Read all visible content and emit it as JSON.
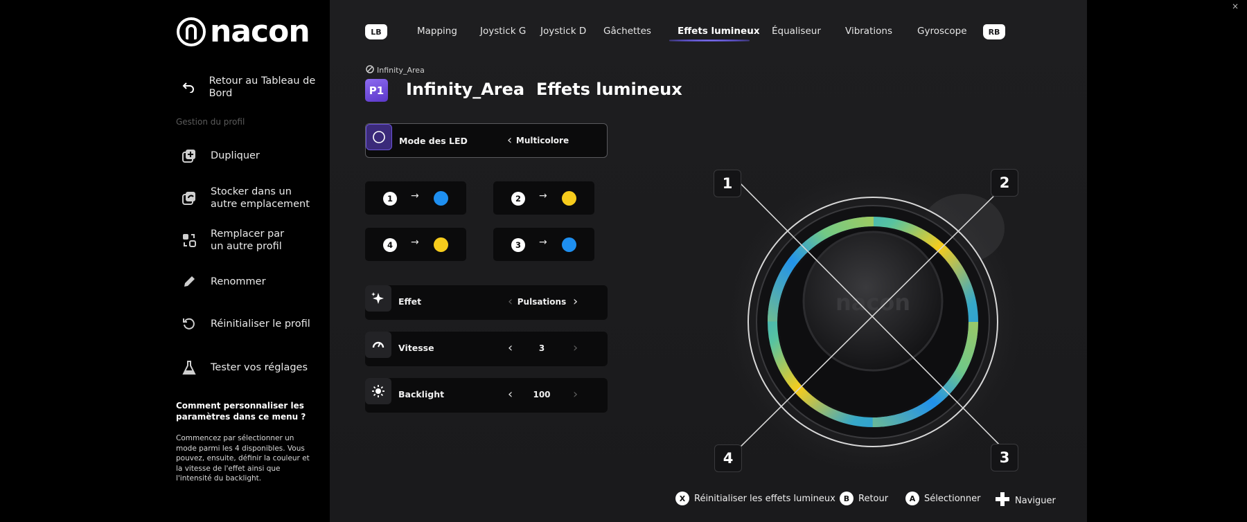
{
  "brand": {
    "logo_text": "nacon"
  },
  "sidebar": {
    "back_label": "Retour au Tableau de Bord",
    "section_label": "Gestion du profil",
    "items": [
      {
        "label": "Dupliquer",
        "icon": "duplicate-icon"
      },
      {
        "label": "Stocker dans un\nautre emplacement",
        "icon": "store-icon"
      },
      {
        "label": "Remplacer par\nun autre profil",
        "icon": "replace-icon"
      },
      {
        "label": "Renommer",
        "icon": "pencil-icon"
      },
      {
        "label": "Réinitialiser le profil",
        "icon": "reset-icon"
      },
      {
        "label": "Tester vos réglages",
        "icon": "flask-icon"
      }
    ],
    "help_title": "Comment personnaliser les paramètres dans ce menu ?",
    "help_text": "Commencez par sélectionner un mode parmi les 4 disponibles. Vous pouvez, ensuite, définir la couleur et la vitesse de l'effet ainsi que l'intensité du backlight."
  },
  "tabs": {
    "left_bumper": "LB",
    "right_bumper": "RB",
    "items": [
      "Mapping",
      "Joystick G",
      "Joystick D",
      "Gâchettes",
      "Effets lumineux",
      "Équaliseur",
      "Vibrations",
      "Gyroscope"
    ],
    "active": "Effets lumineux"
  },
  "breadcrumb": {
    "small": "Infinity_Area",
    "badge": "P1",
    "profile": "Infinity_Area",
    "page": "Effets lumineux"
  },
  "led_mode": {
    "label": "Mode des LED",
    "value": "Multicolore"
  },
  "zones": [
    {
      "num": "1",
      "color": "#1e8ff0"
    },
    {
      "num": "2",
      "color": "#f7cc1c"
    },
    {
      "num": "4",
      "color": "#f7cc1c"
    },
    {
      "num": "3",
      "color": "#1e8ff0"
    }
  ],
  "effect": {
    "label": "Effet",
    "value": "Pulsations"
  },
  "speed": {
    "label": "Vitesse",
    "value": "3"
  },
  "backlight": {
    "label": "Backlight",
    "value": "100"
  },
  "stick": {
    "logo_text": "nacon",
    "callouts": [
      "1",
      "2",
      "3",
      "4"
    ]
  },
  "footer": [
    {
      "btn": "X",
      "label": "Réinitialiser les effets lumineux"
    },
    {
      "btn": "B",
      "label": "Retour"
    },
    {
      "btn": "A",
      "label": "Sélectionner"
    },
    {
      "btn": "+",
      "label": "Naviguer"
    }
  ],
  "colors": {
    "blue": "#1e8ff0",
    "yellow": "#f7cc1c",
    "accent": "#6c55d8"
  }
}
